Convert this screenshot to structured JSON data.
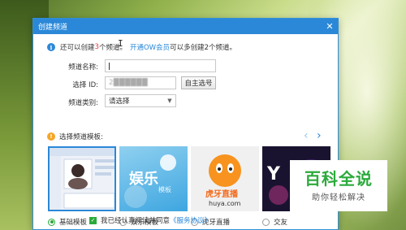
{
  "window": {
    "title": "创建频道",
    "close_glyph": "✕"
  },
  "info": {
    "prefix": "还可以创建 ",
    "count": "3",
    "suffix": " 个频道。",
    "link": "开通OW会员",
    "note": " 可以多创建2个频道。"
  },
  "form": {
    "name_label": "频道名称:",
    "name_value": "",
    "id_label": "选择 ID:",
    "id_value": "2██████",
    "id_button": "自主选号",
    "type_label": "频道类别:",
    "type_value": "请选择",
    "type_chevron": "▼"
  },
  "templates": {
    "header": "选择频道模板:",
    "prev_glyph": "‹",
    "next_glyph": "›",
    "items": [
      {
        "label": "基础模板",
        "selected": true
      },
      {
        "label": "娱乐模板",
        "selected": false
      },
      {
        "label": "虎牙直播",
        "selected": false
      },
      {
        "label": "交友",
        "selected": false
      }
    ],
    "thumb_texts": {
      "t2_main": "娱乐",
      "t2_sub": "模板",
      "t3_main": "虎牙直播",
      "t3_sub": "huya.com",
      "t4_main": "Y"
    }
  },
  "agreement": {
    "checked": true,
    "text": "我已经认真阅读并同意",
    "link": "《服务协议》"
  },
  "watermark": {
    "big": "百科全说",
    "small": "助你轻松解决"
  },
  "colors": {
    "accent": "#2b88d8",
    "green": "#2baa3b",
    "warn": "#f5a623",
    "highlight": "#e4393c"
  }
}
